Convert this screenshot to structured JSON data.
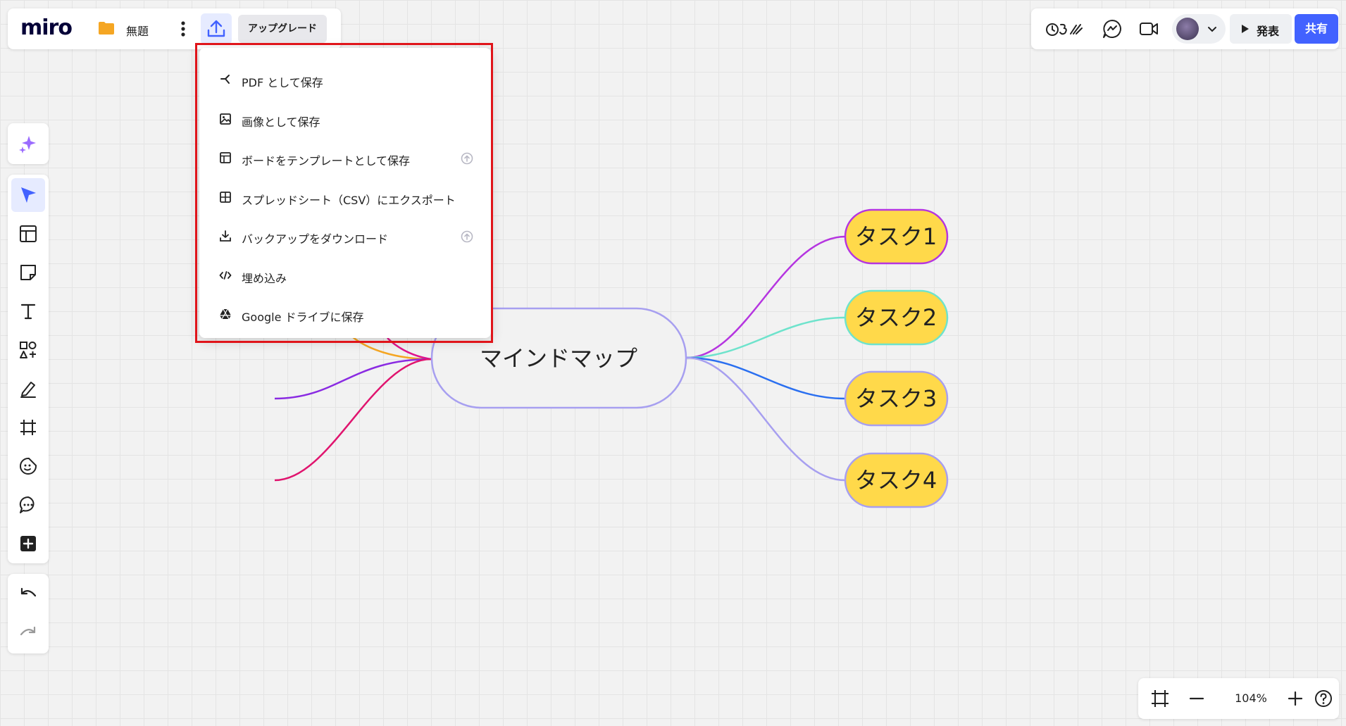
{
  "app": {
    "logo": "miro",
    "board_title": "無題",
    "upgrade_label": "アップグレード"
  },
  "header_right": {
    "present_label": "発表",
    "share_label": "共有"
  },
  "export_menu": {
    "items": [
      {
        "label": "PDF として保存",
        "icon": "pdf-icon",
        "upgrade": false
      },
      {
        "label": "画像として保存",
        "icon": "image-icon",
        "upgrade": false
      },
      {
        "label": "ボードをテンプレートとして保存",
        "icon": "template-icon",
        "upgrade": true
      },
      {
        "label": "スプレッドシート（CSV）にエクスポート",
        "icon": "spreadsheet-icon",
        "upgrade": false
      },
      {
        "label": "バックアップをダウンロード",
        "icon": "download-icon",
        "upgrade": true
      },
      {
        "label": "埋め込み",
        "icon": "embed-icon",
        "upgrade": false
      },
      {
        "label": "Google ドライブに保存",
        "icon": "google-drive-icon",
        "upgrade": false
      }
    ]
  },
  "mindmap": {
    "root": "マインドマップ",
    "tasks": [
      {
        "label": "タスク1",
        "border": "#b535e0",
        "line": "#b535e0"
      },
      {
        "label": "タスク2",
        "border": "#6ee3cc",
        "line": "#6ee3cc"
      },
      {
        "label": "タスク3",
        "border": "#a79ff0",
        "line": "#2a6ff0"
      },
      {
        "label": "タスク4",
        "border": "#a79ff0",
        "line": "#a79ff0"
      }
    ],
    "node_fill": "#ffd94a"
  },
  "zoom": {
    "level": "104%"
  },
  "colors": {
    "accent": "#4262ff",
    "highlight": "#e0141a"
  }
}
